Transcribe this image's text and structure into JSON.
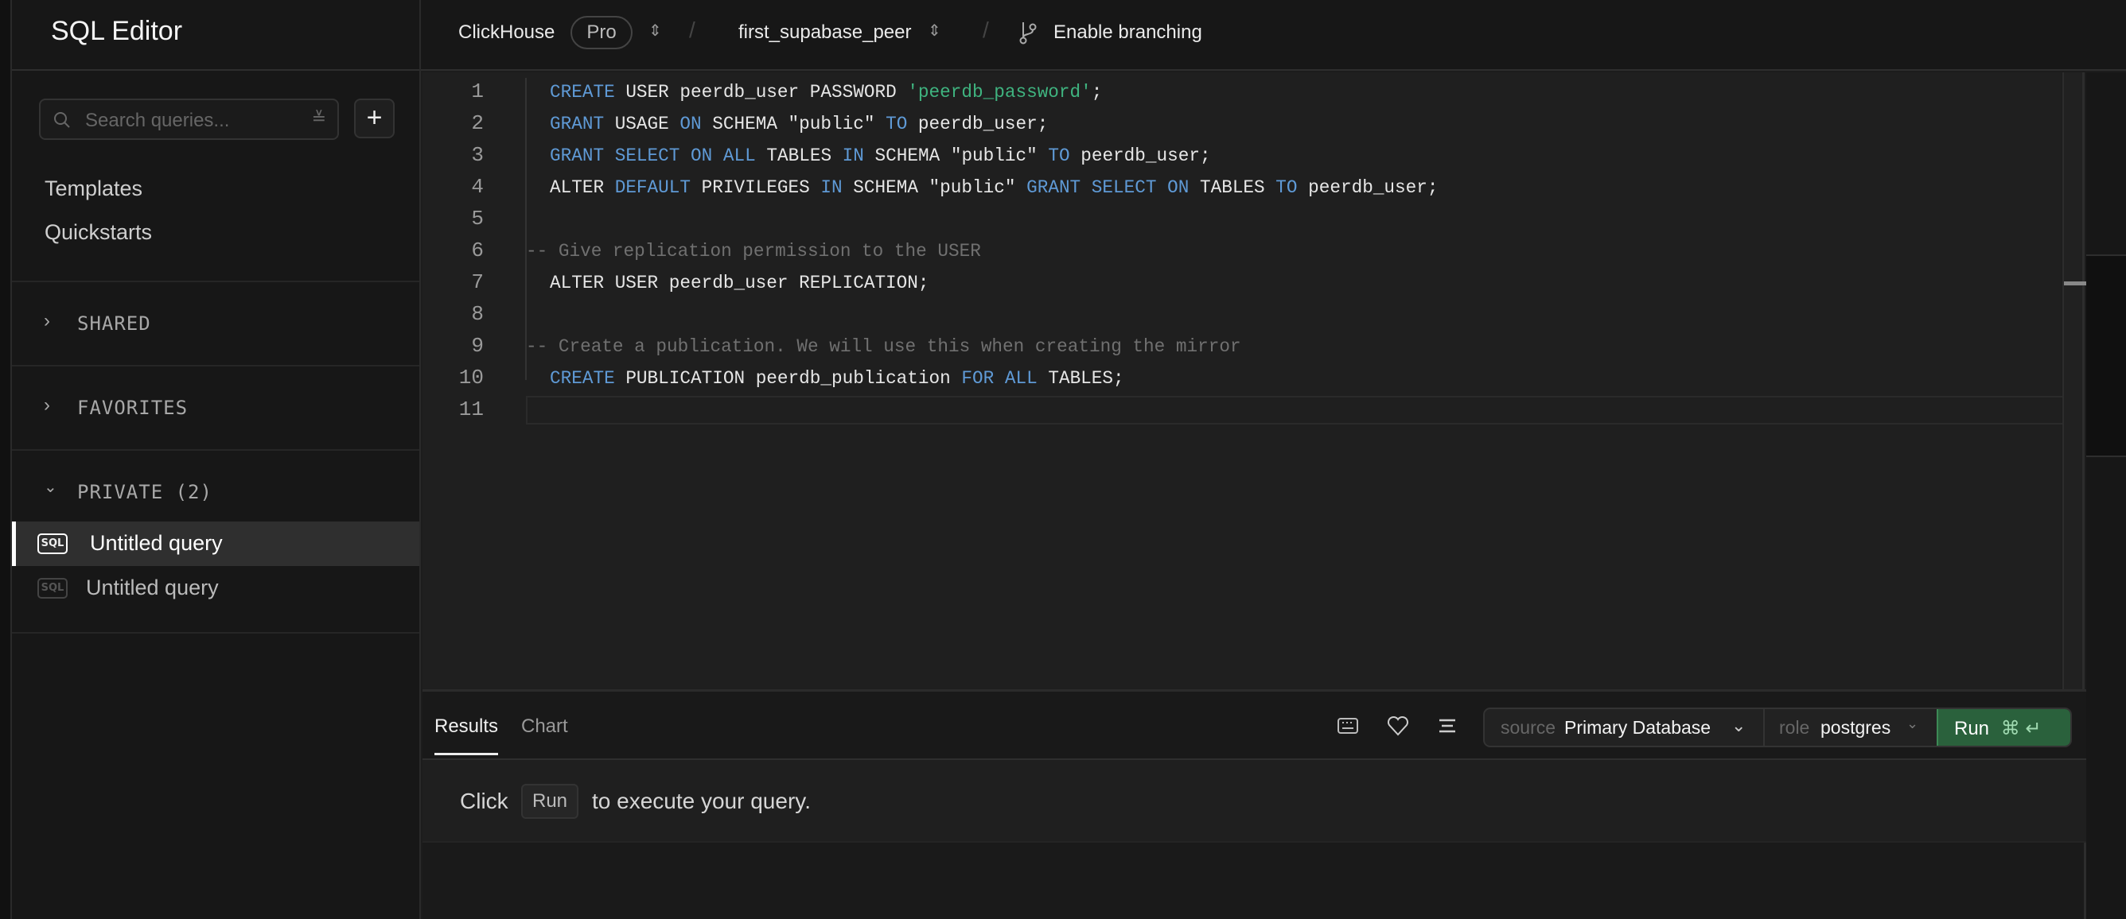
{
  "sidebar": {
    "title": "SQL Editor",
    "search_placeholder": "Search queries...",
    "links": [
      "Templates",
      "Quickstarts"
    ],
    "sections": [
      "SHARED",
      "FAVORITES",
      "PRIVATE (2)"
    ],
    "queries": [
      {
        "label": "Untitled query",
        "selected": true
      },
      {
        "label": "Untitled query",
        "selected": false
      }
    ],
    "sql_badge": "SQL"
  },
  "topbar": {
    "org": "ClickHouse",
    "plan": "Pro",
    "project": "first_supabase_peer",
    "branching": "Enable branching"
  },
  "editor": {
    "line_numbers": [
      "1",
      "2",
      "3",
      "4",
      "5",
      "6",
      "7",
      "8",
      "9",
      "10",
      "11"
    ],
    "lines": [
      [
        {
          "t": "CREATE",
          "c": "kw"
        },
        {
          "t": " USER peerdb_user PASSWORD "
        },
        {
          "t": "'peerdb_password'",
          "c": "str"
        },
        {
          "t": ";"
        }
      ],
      [
        {
          "t": "GRANT",
          "c": "kw"
        },
        {
          "t": " USAGE "
        },
        {
          "t": "ON",
          "c": "kw"
        },
        {
          "t": " SCHEMA \"public\" "
        },
        {
          "t": "TO",
          "c": "kw"
        },
        {
          "t": " peerdb_user;"
        }
      ],
      [
        {
          "t": "GRANT",
          "c": "kw"
        },
        {
          "t": " "
        },
        {
          "t": "SELECT",
          "c": "kw"
        },
        {
          "t": " "
        },
        {
          "t": "ON",
          "c": "kw"
        },
        {
          "t": " "
        },
        {
          "t": "ALL",
          "c": "kw"
        },
        {
          "t": " TABLES "
        },
        {
          "t": "IN",
          "c": "kw"
        },
        {
          "t": " SCHEMA \"public\" "
        },
        {
          "t": "TO",
          "c": "kw"
        },
        {
          "t": " peerdb_user;"
        }
      ],
      [
        {
          "t": "ALTER "
        },
        {
          "t": "DEFAULT",
          "c": "kw"
        },
        {
          "t": " PRIVILEGES "
        },
        {
          "t": "IN",
          "c": "kw"
        },
        {
          "t": " SCHEMA \"public\" "
        },
        {
          "t": "GRANT",
          "c": "kw"
        },
        {
          "t": " "
        },
        {
          "t": "SELECT",
          "c": "kw"
        },
        {
          "t": " "
        },
        {
          "t": "ON",
          "c": "kw"
        },
        {
          "t": " TABLES "
        },
        {
          "t": "TO",
          "c": "kw"
        },
        {
          "t": " peerdb_user;"
        }
      ],
      [],
      [
        {
          "t": "-- Give replication permission to the USER",
          "c": "cm"
        }
      ],
      [
        {
          "t": "ALTER USER peerdb_user REPLICATION;"
        }
      ],
      [],
      [
        {
          "t": "-- Create a publication. We will use this when creating the mirror",
          "c": "cm"
        }
      ],
      [
        {
          "t": "CREATE",
          "c": "kw"
        },
        {
          "t": " PUBLICATION peerdb_publication "
        },
        {
          "t": "FOR",
          "c": "kw"
        },
        {
          "t": " "
        },
        {
          "t": "ALL",
          "c": "kw"
        },
        {
          "t": " TABLES;"
        }
      ],
      []
    ]
  },
  "results": {
    "tabs": [
      "Results",
      "Chart"
    ],
    "source_label": "source",
    "source_value": "Primary Database",
    "role_label": "role",
    "role_value": "postgres",
    "run_label": "Run",
    "run_shortcut": "⌘ ↵",
    "msg_before": "Click",
    "msg_kbd": "Run",
    "msg_after": "to execute your query."
  },
  "colors": {
    "keyword": "#5f9ad6",
    "string": "#3fb37f",
    "comment": "#707070",
    "run_button": "#2a613c"
  }
}
